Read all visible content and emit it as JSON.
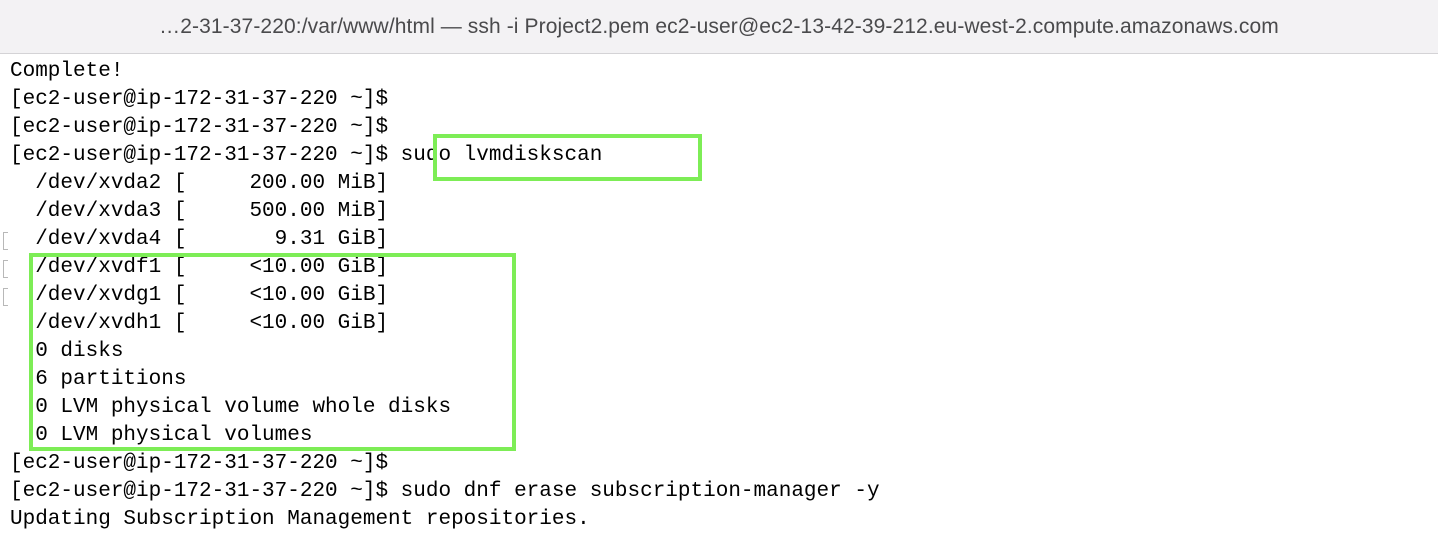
{
  "window": {
    "title": "…2-31-37-220:/var/www/html — ssh -i Project2.pem ec2-user@ec2-13-42-39-212.eu-west-2.compute.amazonaws.com"
  },
  "terminal": {
    "lines": [
      "Complete!",
      "[ec2-user@ip-172-31-37-220 ~]$",
      "[ec2-user@ip-172-31-37-220 ~]$",
      "[ec2-user@ip-172-31-37-220 ~]$ sudo lvmdiskscan",
      "  /dev/xvda2 [     200.00 MiB]",
      "  /dev/xvda3 [     500.00 MiB]",
      "  /dev/xvda4 [       9.31 GiB]",
      "  /dev/xvdf1 [     <10.00 GiB]",
      "  /dev/xvdg1 [     <10.00 GiB]",
      "  /dev/xvdh1 [     <10.00 GiB]",
      "  0 disks",
      "  6 partitions",
      "  0 LVM physical volume whole disks",
      "  0 LVM physical volumes",
      "[ec2-user@ip-172-31-37-220 ~]$",
      "[ec2-user@ip-172-31-37-220 ~]$ sudo dnf erase subscription-manager -y",
      "Updating Subscription Management repositories."
    ]
  },
  "colors": {
    "highlight": "#7ded56",
    "titlebar_bg": "#f3f2f4",
    "text": "#000000"
  }
}
